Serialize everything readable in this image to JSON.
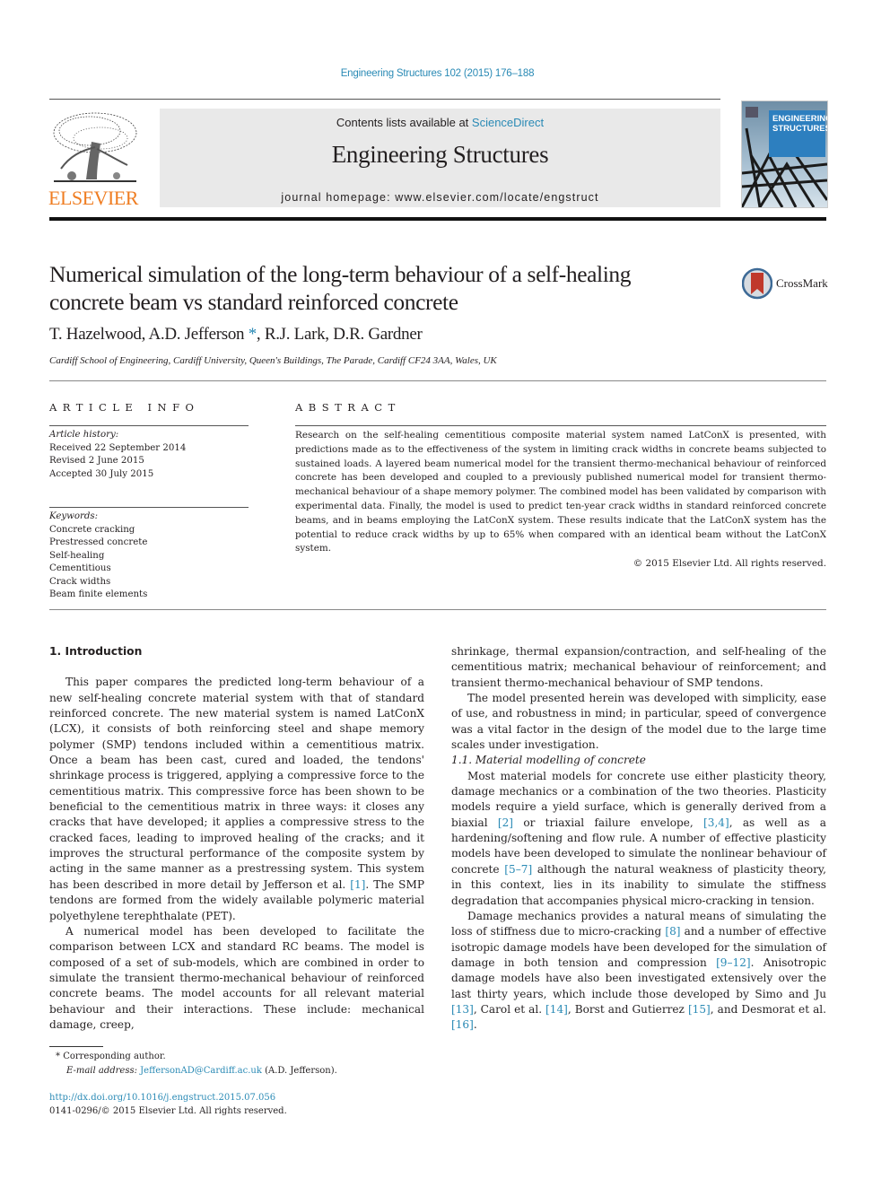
{
  "header": {
    "journal_ref": "Engineering Structures 102 (2015) 176–188",
    "contents_prefix": "Contents lists available at ",
    "contents_link": "ScienceDirect",
    "journal_name": "Engineering Structures",
    "homepage_label": "journal homepage: ",
    "homepage_url": "www.elsevier.com/locate/engstruct",
    "publisher_logo_text": "ELSEVIER",
    "cover_title_line1": "ENGINEERING",
    "cover_title_line2": "STRUCTURES",
    "crossmark_label": "CrossMark"
  },
  "colors": {
    "link": "#2a8ab5",
    "elsevier_orange": "#ef7d22",
    "masthead_bg": "#e9e9e9",
    "cover_blue": "#2d7fbf"
  },
  "article": {
    "title_line1": "Numerical simulation of the long-term behaviour of a self-healing",
    "title_line2": "concrete beam vs standard reinforced concrete",
    "authors_before": "T. Hazelwood, A.D. Jefferson",
    "author_mark": "*",
    "authors_after": ", R.J. Lark, D.R. Gardner",
    "affiliation": "Cardiff School of Engineering, Cardiff University, Queen's Buildings, The Parade, Cardiff CF24 3AA, Wales, UK"
  },
  "article_info": {
    "heading": "ARTICLE INFO",
    "history_label": "Article history:",
    "history": [
      "Received 22 September 2014",
      "Revised 2 June 2015",
      "Accepted 30 July 2015"
    ],
    "keywords_label": "Keywords:",
    "keywords": [
      "Concrete cracking",
      "Prestressed concrete",
      "Self-healing",
      "Cementitious",
      "Crack widths",
      "Beam finite elements"
    ]
  },
  "abstract": {
    "heading": "ABSTRACT",
    "text": "Research on the self-healing cementitious composite material system named LatConX is presented, with predictions made as to the effectiveness of the system in limiting crack widths in concrete beams subjected to sustained loads. A layered beam numerical model for the transient thermo-mechanical behaviour of reinforced concrete has been developed and coupled to a previously published numerical model for transient thermo-mechanical behaviour of a shape memory polymer. The combined model has been validated by comparison with experimental data. Finally, the model is used to predict ten-year crack widths in standard reinforced concrete beams, and in beams employing the LatConX system. These results indicate that the LatConX system has the potential to reduce crack widths by up to 65% when compared with an identical beam without the LatConX system.",
    "copyright": "© 2015 Elsevier Ltd. All rights reserved."
  },
  "body": {
    "section1_heading": "1. Introduction",
    "p1_a": "This paper compares the predicted long-term behaviour of a new self-healing concrete material system with that of standard reinforced concrete. The new material system is named LatConX (LCX), it consists of both reinforcing steel and shape memory polymer (SMP) tendons included within a cementitious matrix. Once a beam has been cast, cured and loaded, the tendons' shrinkage process is triggered, applying a compressive force to the cementitious matrix. This compressive force has been shown to be beneficial to the cementitious matrix in three ways: it closes any cracks that have developed; it applies a compressive stress to the cracked faces, leading to improved healing of the cracks; and it improves the structural performance of the composite system by acting in the same manner as a prestressing system. This system has been described in more detail by Jefferson et al. ",
    "p1_cite": "[1]",
    "p1_b": ". The SMP tendons are formed from the widely available polymeric material polyethylene terephthalate (PET).",
    "p2": "A numerical model has been developed to facilitate the comparison between LCX and standard RC beams. The model is composed of a set of sub-models, which are combined in order to simulate the transient thermo-mechanical behaviour of reinforced concrete beams. The model accounts for all relevant material behaviour and their interactions. These include: mechanical damage, creep,",
    "r_p0": "shrinkage, thermal expansion/contraction, and self-healing of the cementitious matrix; mechanical behaviour of reinforcement; and transient thermo-mechanical behaviour of SMP tendons.",
    "r_p1": "The model presented herein was developed with simplicity, ease of use, and robustness in mind; in particular, speed of convergence was a vital factor in the design of the model due to the large time scales under investigation.",
    "subsection_heading": "1.1. Material modelling of concrete",
    "r_p2_a": "Most material models for concrete use either plasticity theory, damage mechanics or a combination of the two theories. Plasticity models require a yield surface, which is generally derived from a biaxial ",
    "r_p2_c1": "[2]",
    "r_p2_b": " or triaxial failure envelope, ",
    "r_p2_c2": "[3,4]",
    "r_p2_c": ", as well as a hardening/softening and flow rule. A number of effective plasticity models have been developed to simulate the nonlinear behaviour of concrete ",
    "r_p2_c3": "[5–7]",
    "r_p2_d": " although the natural weakness of plasticity theory, in this context, lies in its inability to simulate the stiffness degradation that accompanies physical micro-cracking in tension.",
    "r_p3_a": "Damage mechanics provides a natural means of simulating the loss of stiffness due to micro-cracking ",
    "r_p3_c1": "[8]",
    "r_p3_b": " and a number of effective isotropic damage models have been developed for the simulation of damage in both tension and compression ",
    "r_p3_c2": "[9–12]",
    "r_p3_c": ". Anisotropic damage models have also been investigated extensively over the last thirty years, which include those developed by Simo and Ju ",
    "r_p3_c3": "[13]",
    "r_p3_d": ", Carol et al. ",
    "r_p3_c4": "[14]",
    "r_p3_e": ", Borst and Gutierrez ",
    "r_p3_c5": "[15]",
    "r_p3_f": ", and Desmorat et al. ",
    "r_p3_c6": "[16]",
    "r_p3_g": "."
  },
  "footnote": {
    "mark": "*",
    "corresponding": "Corresponding author.",
    "email_label": "E-mail address: ",
    "email": "JeffersonAD@Cardiff.ac.uk",
    "email_suffix": " (A.D. Jefferson).",
    "doi": "http://dx.doi.org/10.1016/j.engstruct.2015.07.056",
    "issn_line": "0141-0296/© 2015 Elsevier Ltd. All rights reserved."
  }
}
